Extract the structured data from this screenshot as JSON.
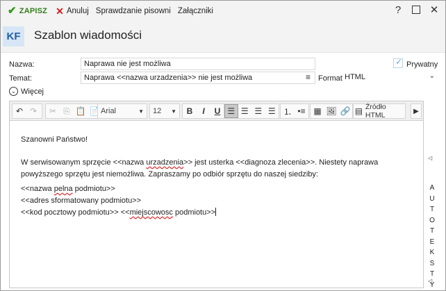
{
  "toolbar": {
    "save_label": "ZAPISZ",
    "cancel_label": "Anuluj",
    "spellcheck_label": "Sprawdzanie pisowni",
    "attachments_label": "Załączniki",
    "help_glyph": "?"
  },
  "header": {
    "avatar_initials": "KF",
    "title": "Szablon wiadomości"
  },
  "form": {
    "name_label": "Nazwa:",
    "name_value": "Naprawa nie jest możliwa",
    "private_label": "Prywatny",
    "private_checked": true,
    "subject_label": "Temat:",
    "subject_value": "Naprawa <<nazwa urzadzenia>> nie jest możliwa",
    "format_label": "Format:",
    "format_value": "HTML",
    "more_label": "Więcej"
  },
  "editor_toolbar": {
    "font_family": "Arial",
    "font_size": "12",
    "bold": "B",
    "italic": "I",
    "underline": "U",
    "source_label": "Źródło HTML",
    "icons": [
      "undo-icon",
      "redo-icon",
      "cut-icon",
      "copy-icon",
      "paste-icon",
      "paste-text-icon",
      "align-left-icon",
      "align-center-icon",
      "align-right-icon",
      "justify-icon",
      "numbered-list-icon",
      "bulleted-list-icon",
      "table-icon",
      "image-icon",
      "link-icon",
      "source-icon",
      "more-arrow-icon"
    ]
  },
  "editor_body": {
    "greeting": "Szanowni Państwo!",
    "para_pre": "W serwisowanym sprzęcie <<nazwa ",
    "para_sp1": "urzadzenia",
    "para_post": ">> jest usterka <<diagnoza zlecenia>>. Niestety naprawa powyższego sprzętu jest niemożliwa. Zapraszamy po odbiór sprzętu do naszej siedziby:",
    "line1_pre": "<<nazwa ",
    "line1_sp": "pelna",
    "line1_post": " podmiotu>>",
    "line2": "<<adres sformatowany podmiotu>>",
    "line3_pre": "<<kod pocztowy podmiotu>> <<",
    "line3_sp": "miejscowosc",
    "line3_post": " podmiotu>>"
  },
  "side_panel": {
    "label": "AUTOTEKSTY"
  },
  "colors": {
    "save_green": "#2f9a19",
    "cancel_red": "#d51c1c",
    "avatar_bg": "#d6e6f6",
    "avatar_fg": "#1f5fa4"
  }
}
